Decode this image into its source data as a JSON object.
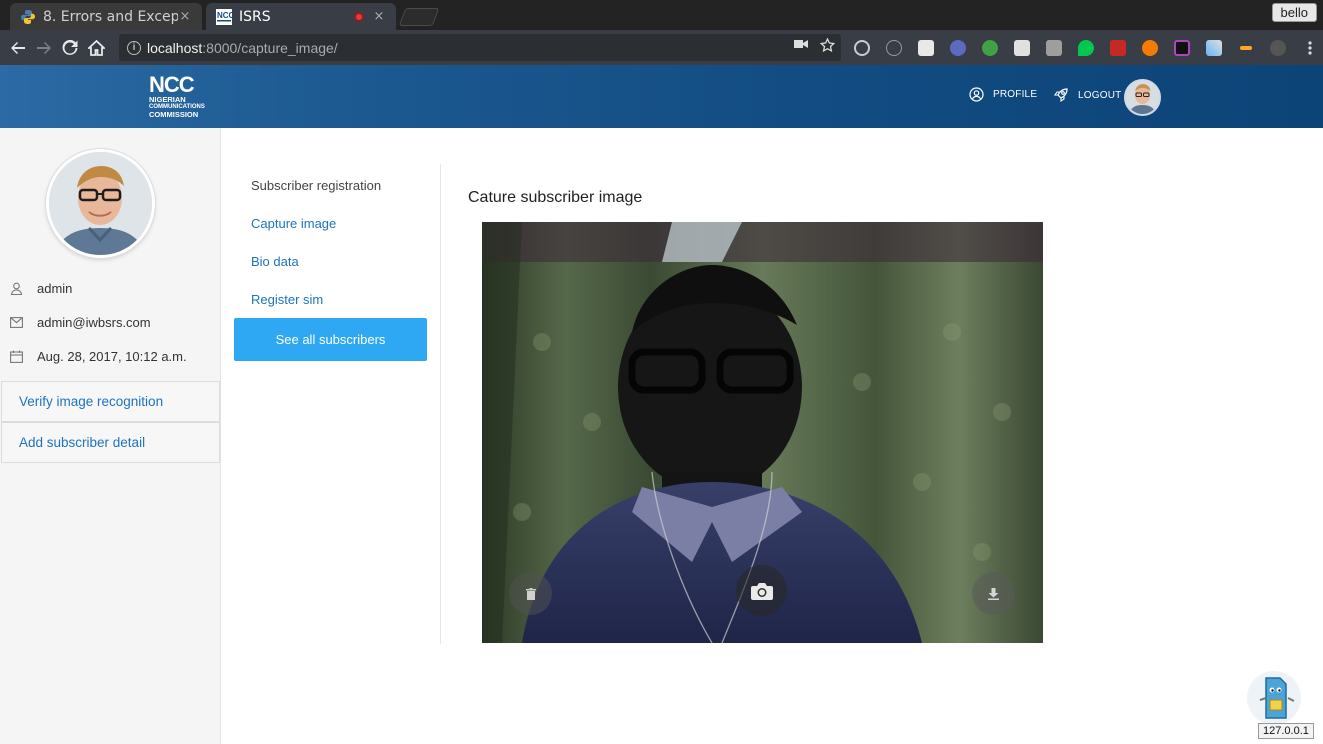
{
  "browser": {
    "tabs": [
      {
        "title": "8. Errors and Excep",
        "close": "×"
      },
      {
        "title": "ISRS",
        "close": "×"
      }
    ],
    "profile_name": "bello",
    "url_host": "localhost",
    "url_rest": ":8000/capture_image/",
    "nav_icons": [
      "back-arrow-icon",
      "forward-arrow-icon",
      "reload-icon",
      "home-icon"
    ]
  },
  "header": {
    "logo_mark": "NCC",
    "logo_lines": [
      "NIGERIAN",
      "COMMUNICATIONS",
      "COMMISSION"
    ],
    "profile_label": "PROFILE",
    "logout_label": "LOGOUT"
  },
  "sidebar": {
    "username": "admin",
    "email": "admin@iwbsrs.com",
    "joined": "Aug. 28, 2017, 10:12 a.m.",
    "links": [
      {
        "label": "Verify image recognition"
      },
      {
        "label": "Add subscriber detail"
      }
    ]
  },
  "subnav": {
    "heading": "Subscriber registration",
    "links": [
      {
        "label": "Capture image"
      },
      {
        "label": "Bio data"
      },
      {
        "label": "Register sim"
      }
    ],
    "see_all_label": "See all subscribers"
  },
  "main": {
    "title": "Cature subscriber image",
    "camera_controls": [
      "trash-icon",
      "camera-icon",
      "download-icon"
    ]
  },
  "footer_badge": {
    "host": "127.0.0.1"
  },
  "colors": {
    "header_blue": "#124c82",
    "link_blue": "#1e73be",
    "button_blue": "#2ea8f3"
  }
}
